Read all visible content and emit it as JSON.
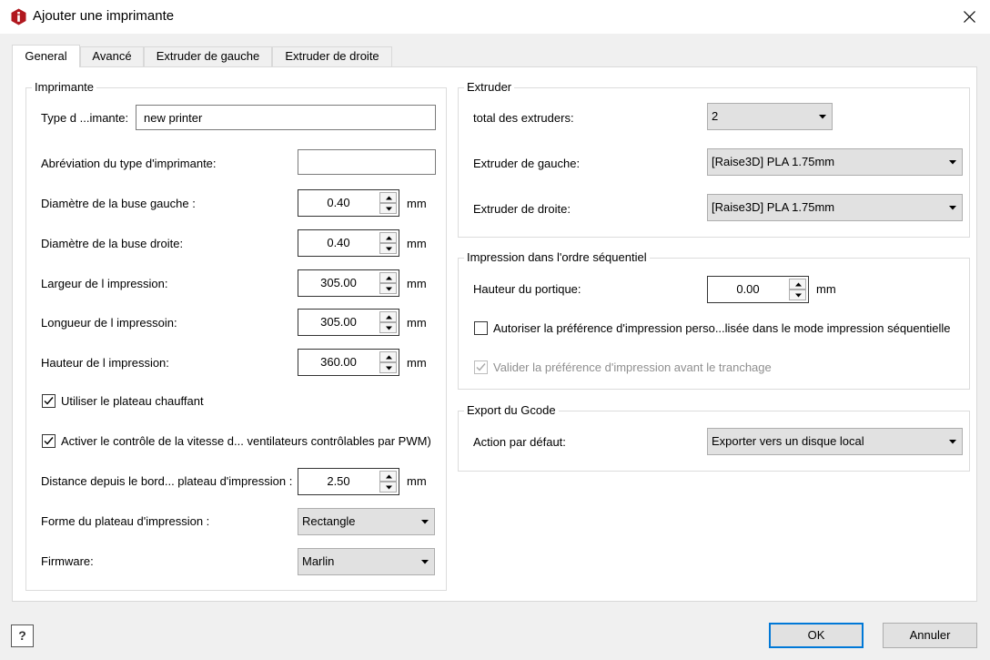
{
  "window": {
    "title": "Ajouter une imprimante",
    "app_icon": "raise3d-logo-icon",
    "close_icon": "close-icon"
  },
  "tabs": [
    {
      "label": "General",
      "active": true
    },
    {
      "label": "Avancé",
      "active": false
    },
    {
      "label": "Extruder de gauche",
      "active": false
    },
    {
      "label": "Extruder de droite",
      "active": false
    }
  ],
  "printer": {
    "group_title": "Imprimante",
    "type_label": "Type d ...imante:",
    "type_value": "new printer",
    "abbrev_label": "Abréviation du type d'imprimante:",
    "abbrev_value": "",
    "nozzle_left_label": "Diamètre de la buse gauche :",
    "nozzle_left_value": "0.40",
    "nozzle_right_label": "Diamètre de la buse droite:",
    "nozzle_right_value": "0.40",
    "width_label": "Largeur de l impression:",
    "width_value": "305.00",
    "length_label": "Longueur de l impressoin:",
    "length_value": "305.00",
    "height_label": "Hauteur de l impression:",
    "height_value": "360.00",
    "heated_bed_label": "Utiliser le plateau chauffant",
    "heated_bed_checked": true,
    "fan_pwm_label": "Activer le contrôle de la vitesse d... ventilateurs contrôlables par PWM)",
    "fan_pwm_checked": true,
    "edge_distance_label": "Distance depuis le bord... plateau d'impression :",
    "edge_distance_value": "2.50",
    "bed_shape_label": "Forme du plateau d'impression :",
    "bed_shape_value": "Rectangle",
    "firmware_label": "Firmware:",
    "firmware_value": "Marlin",
    "unit": "mm"
  },
  "extruder": {
    "group_title": "Extruder",
    "total_label": "total des extruders:",
    "total_value": "2",
    "left_label": "Extruder de gauche:",
    "left_value": "[Raise3D] PLA 1.75mm",
    "right_label": "Extruder de droite:",
    "right_value": "[Raise3D] PLA 1.75mm"
  },
  "sequential": {
    "group_title": "Impression dans l'ordre séquentiel",
    "gantry_label": "Hauteur du portique:",
    "gantry_value": "0.00",
    "unit": "mm",
    "allow_custom_label": "Autoriser la préférence d'impression perso...lisée dans le mode impression séquentielle",
    "allow_custom_checked": false,
    "validate_label": "Valider la préférence d'impression avant le tranchage",
    "validate_checked": true,
    "validate_disabled": true
  },
  "gcode": {
    "group_title": "Export du Gcode",
    "action_label": "Action par défaut:",
    "action_value": "Exporter vers un disque local"
  },
  "footer": {
    "help": "?",
    "ok": "OK",
    "cancel": "Annuler"
  },
  "colors": {
    "accent": "#0078d7",
    "logo_red": "#b1181f"
  }
}
